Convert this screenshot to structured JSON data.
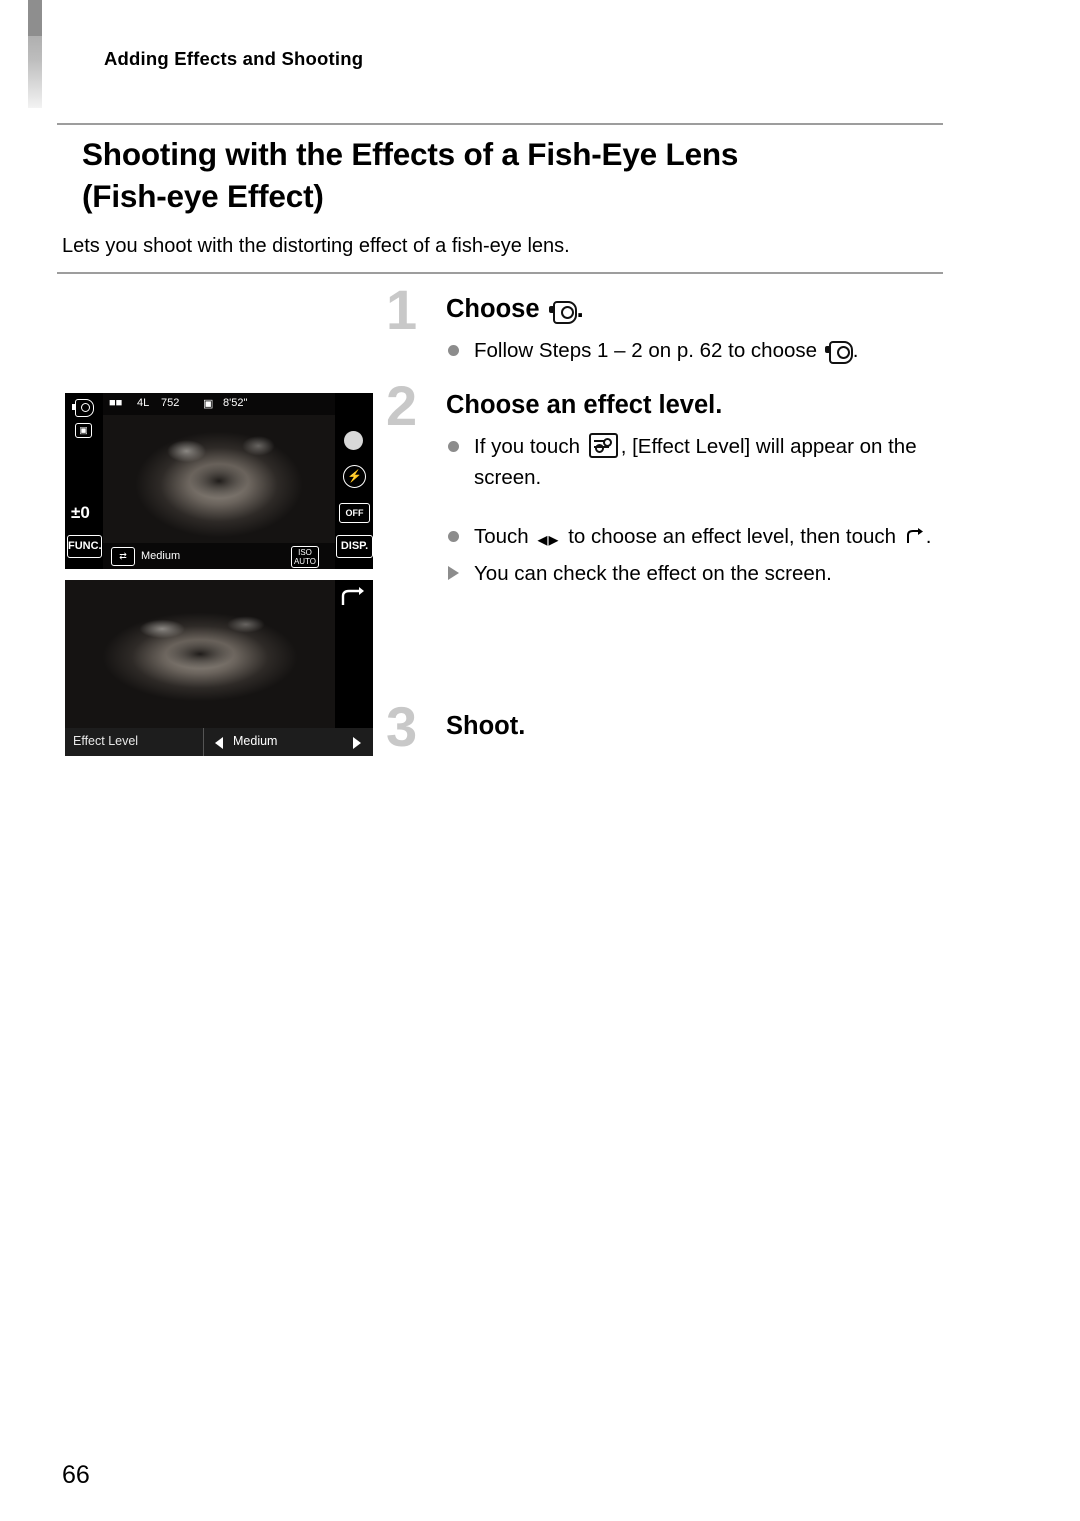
{
  "running_head": "Adding Effects and Shooting",
  "title_line1": "Shooting with the Effects of a Fish-Eye Lens",
  "title_line2": "(Fish-eye Effect)",
  "lead": "Lets you shoot with the distorting effect of a fish-eye lens.",
  "steps": [
    {
      "number": "1",
      "heading_before": "Choose",
      "heading_after": ".",
      "heading_icon": "fisheye-mode-icon",
      "bullets": [
        {
          "kind": "dot",
          "text_before": "Follow Steps 1 – 2 on p. 62 to choose",
          "icon": "fisheye-mode-icon",
          "text_after": "."
        }
      ]
    },
    {
      "number": "2",
      "heading_before": "Choose an effect level.",
      "heading_after": "",
      "bullets": [
        {
          "kind": "dot",
          "text_before": "If you touch",
          "icon": "effect-level-icon",
          "text_after": ", [Effect Level] will appear on the screen."
        },
        {
          "kind": "dot",
          "text_before": "Touch",
          "icon": "left-right-arrows-icon",
          "text_mid": "to choose an effect level, then touch",
          "icon2": "return-back-icon",
          "text_after": "."
        },
        {
          "kind": "arrow",
          "text_before": "You can check the effect on the screen."
        }
      ]
    },
    {
      "number": "3",
      "heading_before": "Shoot.",
      "heading_after": "",
      "bullets": []
    }
  ],
  "screenshot_top": {
    "name": "camera-screen-shooting",
    "top_bar": {
      "battery_icon": "battery-icon",
      "quality": "4L",
      "remaining_shots": "752",
      "movie_icon": "movie-icon",
      "movie_time": "8'52\""
    },
    "left_icons": {
      "mode_icon": "fisheye-mode-icon",
      "metering_icon": "metering-icon",
      "exposure": "±0",
      "func_label": "FUNC."
    },
    "bottom_bar": {
      "effect_icon": "effect-level-icon",
      "effect_value": "Medium",
      "iso_label": "ISO",
      "iso_value": "AUTO",
      "disp_label": "DISP."
    },
    "right_icons": {
      "shutter_icon": "shutter-button-icon",
      "flash_icon": "flash-icon",
      "off_icon": "flash-off-icon"
    }
  },
  "screenshot_bottom": {
    "name": "camera-screen-effect-level",
    "label": "Effect Level",
    "value": "Medium",
    "left_arrow": "left-arrow-icon",
    "right_arrow": "right-arrow-icon",
    "back_icon": "return-back-icon"
  },
  "page_number": "66"
}
